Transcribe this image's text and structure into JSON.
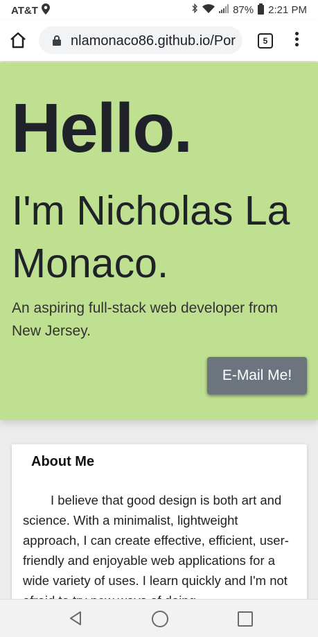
{
  "status_bar": {
    "carrier": "AT&T",
    "battery_percent": "87%",
    "time": "2:21 PM",
    "icons": [
      "location-icon",
      "bluetooth-icon",
      "wifi-icon",
      "signal-icon",
      "battery-icon"
    ]
  },
  "browser": {
    "url": "nlamonaco86.github.io/Por",
    "tab_count": "5"
  },
  "hero": {
    "greeting": "Hello.",
    "name": "I'm Nicholas La Monaco.",
    "tagline": "An aspiring full-stack web developer from New Jersey.",
    "email_button": "E-Mail Me!",
    "background_color": "#bfdf91"
  },
  "about": {
    "title": "About Me",
    "text": "I believe that good design is both art and science. With a minimalist, lightweight approach, I can create effective, efficient, user-friendly and enjoyable web applications for a wide variety of uses. I learn quickly and I'm not afraid to try new ways of doing"
  },
  "nav_bar": {
    "icons": [
      "back-icon",
      "home-icon",
      "recents-icon"
    ]
  }
}
